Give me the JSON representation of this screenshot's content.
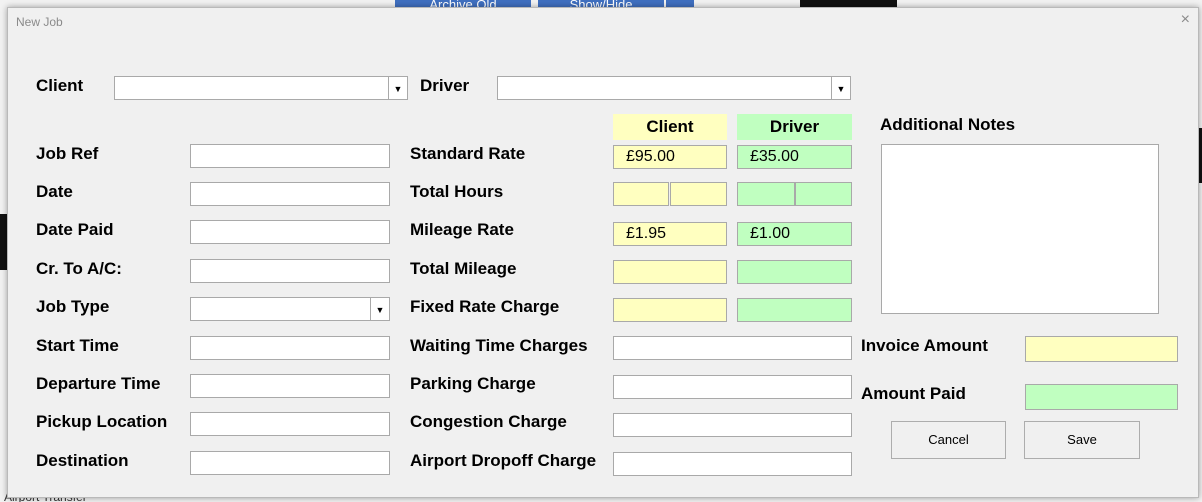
{
  "background": {
    "archive_label": "Archive Old",
    "showhide_label": "Show/Hide",
    "row_text": "Airport Transfer"
  },
  "dialog": {
    "title": "New Job",
    "close_icon": "×"
  },
  "top": {
    "client_label": "Client",
    "client_value": "",
    "driver_label": "Driver",
    "driver_value": ""
  },
  "left_fields": [
    {
      "label": "Job Ref",
      "value": ""
    },
    {
      "label": "Date",
      "value": ""
    },
    {
      "label": "Date Paid",
      "value": ""
    },
    {
      "label": "Cr. To A/C:",
      "value": ""
    },
    {
      "label": "Job Type",
      "value": ""
    },
    {
      "label": "Start Time",
      "value": ""
    },
    {
      "label": "Departure Time",
      "value": ""
    },
    {
      "label": "Pickup Location",
      "value": ""
    },
    {
      "label": "Destination",
      "value": ""
    }
  ],
  "rates": {
    "client_header": "Client",
    "driver_header": "Driver",
    "standard_rate_label": "Standard Rate",
    "standard_rate_client": "£95.00",
    "standard_rate_driver": "£35.00",
    "total_hours_label": "Total Hours",
    "mileage_rate_label": "Mileage Rate",
    "mileage_rate_client": "£1.95",
    "mileage_rate_driver": "£1.00",
    "total_mileage_label": "Total Mileage",
    "fixed_rate_label": "Fixed Rate Charge"
  },
  "charges": {
    "waiting_label": "Waiting Time Charges",
    "parking_label": "Parking Charge",
    "congestion_label": "Congestion Charge",
    "airport_label": "Airport Dropoff Charge"
  },
  "right": {
    "notes_label": "Additional Notes",
    "notes_value": "",
    "invoice_label": "Invoice Amount",
    "invoice_value": "",
    "paid_label": "Amount Paid",
    "paid_value": ""
  },
  "buttons": {
    "cancel": "Cancel",
    "save": "Save"
  },
  "colors": {
    "client_fill": "#ffffc0",
    "driver_fill": "#c0ffc0"
  }
}
